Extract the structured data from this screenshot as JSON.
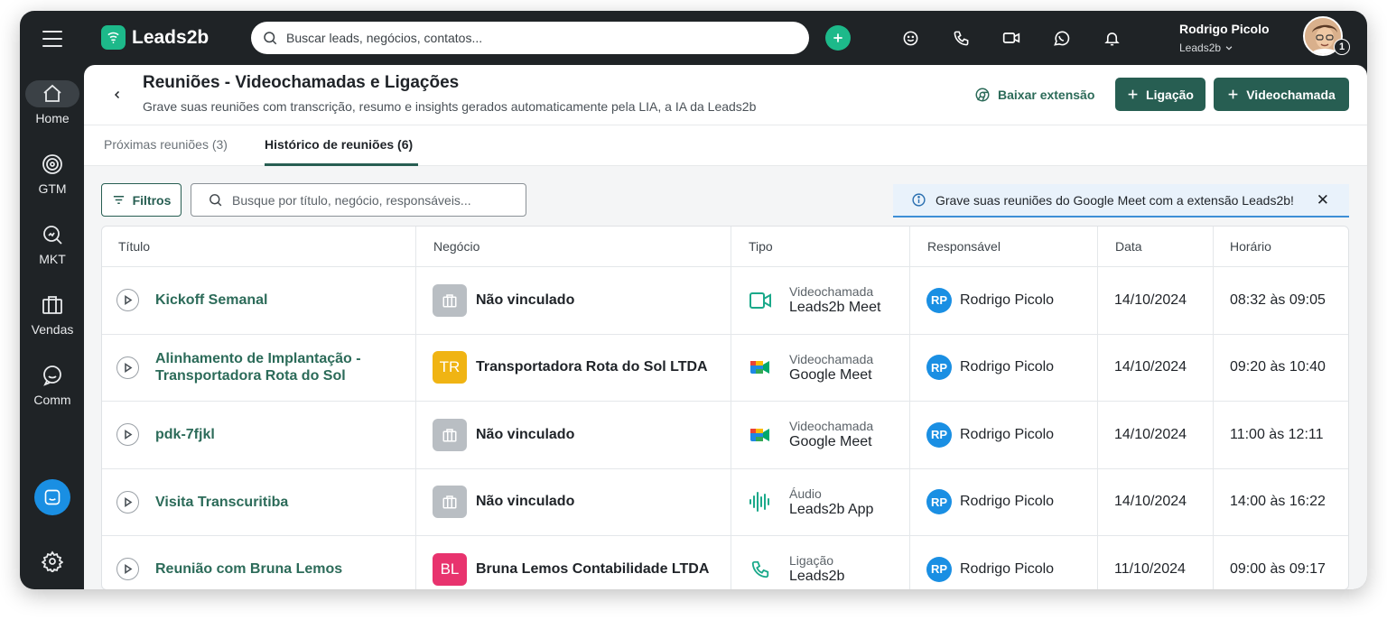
{
  "sidebar": {
    "items": [
      {
        "label": "Home",
        "icon": "home-icon"
      },
      {
        "label": "GTM",
        "icon": "target-icon"
      },
      {
        "label": "MKT",
        "icon": "search-chart-icon"
      },
      {
        "label": "Vendas",
        "icon": "briefcase-icon"
      },
      {
        "label": "Comm",
        "icon": "chat-icon"
      }
    ]
  },
  "topbar": {
    "brand": "Leads2b",
    "search_placeholder": "Buscar leads, negócios, contatos...",
    "user_name": "Rodrigo Picolo",
    "user_company": "Leads2b",
    "avatar_badge": "1"
  },
  "header": {
    "title": "Reuniões - Videochamadas e Ligações",
    "subtitle": "Grave suas reuniões com transcrição, resumo e insights gerados automaticamente pela LIA, a IA da Leads2b",
    "download_ext": "Baixar extensão",
    "btn_call": "Ligação",
    "btn_video": "Videochamada"
  },
  "tabs": [
    {
      "label": "Próximas reuniões (3)",
      "active": false
    },
    {
      "label": "Histórico de reuniões (6)",
      "active": true
    }
  ],
  "toolbar": {
    "filters_label": "Filtros",
    "search_placeholder": "Busque por título, negócio, responsáveis...",
    "banner_text": "Grave suas reuniões do Google Meet com a extensão Leads2b!"
  },
  "table": {
    "columns": [
      "Título",
      "Negócio",
      "Tipo",
      "Responsável",
      "Data",
      "Horário"
    ],
    "rows": [
      {
        "title": "Kickoff Semanal",
        "business": "Não vinculado",
        "biz_initials": "",
        "biz_color": "#b9bec3",
        "type_kind": "Videochamada",
        "type_value": "Leads2b Meet",
        "type_icon": "video-icon",
        "owner": "Rodrigo Picolo",
        "owner_initials": "RP",
        "date": "14/10/2024",
        "time": "08:32 às 09:05"
      },
      {
        "title": "Alinhamento de Implantação - Transportadora Rota do Sol",
        "business": "Transportadora Rota do Sol LTDA",
        "biz_initials": "TR",
        "biz_color": "#f0b413",
        "type_kind": "Videochamada",
        "type_value": "Google Meet",
        "type_icon": "google-meet-icon",
        "owner": "Rodrigo Picolo",
        "owner_initials": "RP",
        "date": "14/10/2024",
        "time": "09:20 às 10:40"
      },
      {
        "title": "pdk-7fjkl",
        "business": "Não vinculado",
        "biz_initials": "",
        "biz_color": "#b9bec3",
        "type_kind": "Videochamada",
        "type_value": "Google Meet",
        "type_icon": "google-meet-icon",
        "owner": "Rodrigo Picolo",
        "owner_initials": "RP",
        "date": "14/10/2024",
        "time": "11:00 às 12:11"
      },
      {
        "title": "Visita Transcuritiba",
        "business": "Não vinculado",
        "biz_initials": "",
        "biz_color": "#b9bec3",
        "type_kind": "Áudio",
        "type_value": "Leads2b App",
        "type_icon": "audio-wave-icon",
        "owner": "Rodrigo Picolo",
        "owner_initials": "RP",
        "date": "14/10/2024",
        "time": "14:00 às 16:22"
      },
      {
        "title": "Reunião com Bruna Lemos",
        "business": "Bruna Lemos Contabilidade LTDA",
        "biz_initials": "BL",
        "biz_color": "#e8336e",
        "type_kind": "Ligação",
        "type_value": "Leads2b",
        "type_icon": "phone-icon",
        "owner": "Rodrigo Picolo",
        "owner_initials": "RP",
        "date": "11/10/2024",
        "time": "09:00 às 09:17"
      }
    ]
  },
  "colors": {
    "accent_dark": "#275e52",
    "accent_green": "#1db98a",
    "link_green": "#2c6b59",
    "info_blue": "#1a8fe3"
  }
}
